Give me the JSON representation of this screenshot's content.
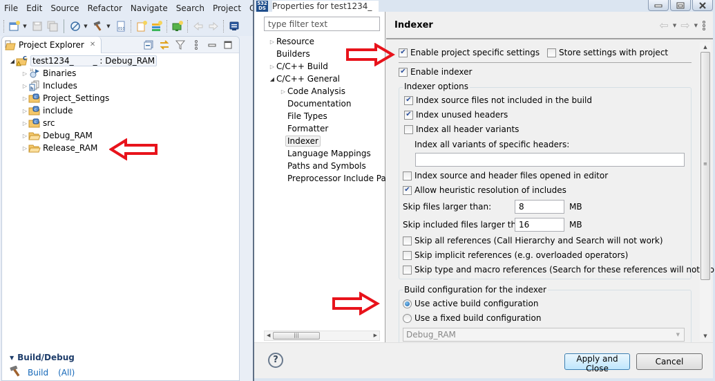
{
  "ide": {
    "menu": [
      "File",
      "Edit",
      "Source",
      "Refactor",
      "Navigate",
      "Search",
      "Project",
      "Conf"
    ],
    "toolbar_icons": [
      "new-wizard-icon",
      "save-icon",
      "save-all-icon",
      "debug-config-icon",
      "build-hammer-icon",
      "binary-file-icon",
      "new-file-icon",
      "new-layers-icon",
      "new-monitor-icon",
      "back-icon",
      "forward-icon",
      "console-icon"
    ],
    "explorer": {
      "tab_label": "Project Explorer",
      "close_glyph": "✕",
      "root": {
        "name": "test1234_",
        "suffix": "_ : Debug_RAM"
      },
      "items": [
        {
          "label": "Binaries",
          "icon": "binaries-icon"
        },
        {
          "label": "Includes",
          "icon": "includes-icon"
        },
        {
          "label": "Project_Settings",
          "icon": "source-folder-icon"
        },
        {
          "label": "include",
          "icon": "source-folder-icon"
        },
        {
          "label": "src",
          "icon": "source-folder-icon"
        },
        {
          "label": "Debug_RAM",
          "icon": "folder-icon"
        },
        {
          "label": "Release_RAM",
          "icon": "folder-icon"
        }
      ]
    },
    "quick": {
      "section_label": "Build/Debug",
      "build_label": "Build",
      "build_scope": "(All)"
    }
  },
  "dialog": {
    "title": "Properties for test1234_",
    "logo_top": "532",
    "logo_bottom": "DS",
    "filter_placeholder": "type filter text",
    "nav": [
      {
        "label": "Resource",
        "level": 0,
        "twisty": "collapsed"
      },
      {
        "label": "Builders",
        "level": 0,
        "twisty": "none"
      },
      {
        "label": "C/C++ Build",
        "level": 0,
        "twisty": "collapsed"
      },
      {
        "label": "C/C++ General",
        "level": 0,
        "twisty": "expanded"
      },
      {
        "label": "Code Analysis",
        "level": 1,
        "twisty": "collapsed"
      },
      {
        "label": "Documentation",
        "level": 1,
        "twisty": "none"
      },
      {
        "label": "File Types",
        "level": 1,
        "twisty": "none"
      },
      {
        "label": "Formatter",
        "level": 1,
        "twisty": "none"
      },
      {
        "label": "Indexer",
        "level": 1,
        "twisty": "none",
        "selected": true
      },
      {
        "label": "Language Mappings",
        "level": 1,
        "twisty": "none"
      },
      {
        "label": "Paths and Symbols",
        "level": 1,
        "twisty": "none"
      },
      {
        "label": "Preprocessor Include Pat",
        "level": 1,
        "twisty": "none"
      }
    ],
    "page_title": "Indexer",
    "enable_project_specific": {
      "label": "Enable project specific settings",
      "checked": true
    },
    "store_with_project": {
      "label": "Store settings with project",
      "checked": false
    },
    "enable_indexer": {
      "label": "Enable indexer",
      "checked": true
    },
    "indexer_options": {
      "title": "Indexer options",
      "index_not_in_build": {
        "label": "Index source files not included in the build",
        "checked": true
      },
      "index_unused_headers": {
        "label": "Index unused headers",
        "checked": true
      },
      "index_all_variants": {
        "label": "Index all header variants",
        "checked": false
      },
      "specific_headers_label": "Index all variants of specific headers:",
      "specific_headers_value": "",
      "index_opened_in_editor": {
        "label": "Index source and header files opened in editor",
        "checked": false
      },
      "heuristic_includes": {
        "label": "Allow heuristic resolution of includes",
        "checked": true
      },
      "skip_larger_label": "Skip files larger than:",
      "skip_larger_value": "8",
      "skip_included_label": "Skip included files larger than:",
      "skip_included_value": "16",
      "unit": "MB",
      "skip_all_refs": {
        "label": "Skip all references (Call Hierarchy and Search will not work)",
        "checked": false
      },
      "skip_implicit_refs": {
        "label": "Skip implicit references (e.g. overloaded operators)",
        "checked": false
      },
      "skip_type_macro_refs": {
        "label": "Skip type and macro references (Search for these references will not work)",
        "checked": false
      }
    },
    "build_config": {
      "title": "Build configuration for the indexer",
      "use_active": {
        "label": "Use active build configuration",
        "selected": true
      },
      "use_fixed": {
        "label": "Use a fixed build configuration",
        "selected": false
      },
      "fixed_value": "Debug_RAM"
    },
    "buttons": {
      "help": "?",
      "apply_close": "Apply and Close",
      "cancel": "Cancel"
    }
  },
  "annotations": {
    "arrow_color": "#e8131b"
  }
}
